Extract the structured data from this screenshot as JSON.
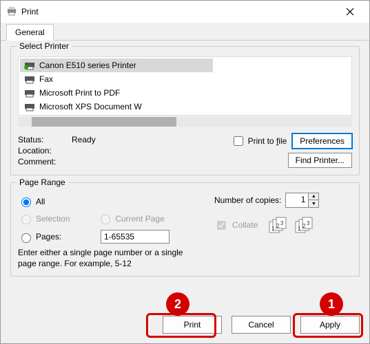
{
  "window": {
    "title": "Print"
  },
  "tabs": {
    "general": "General"
  },
  "select_printer": {
    "legend": "Select Printer",
    "printers": [
      {
        "name": "Canon E510 series Printer"
      },
      {
        "name": "Fax"
      },
      {
        "name": "Microsoft Print to PDF"
      },
      {
        "name": "Microsoft XPS Document W"
      }
    ]
  },
  "status": {
    "status_label": "Status:",
    "status_value": "Ready",
    "location_label": "Location:",
    "location_value": "",
    "comment_label": "Comment:",
    "comment_value": "",
    "print_to_file_prefix": "Print to ",
    "print_to_file_u": "f",
    "print_to_file_suffix": "ile",
    "preferences": "Preferences",
    "find_printer": "Find Printer..."
  },
  "page_range": {
    "legend": "Page Range",
    "all": "All",
    "selection": "Selection",
    "current_page": "Current Page",
    "pages": "Pages:",
    "pages_value": "1-65535",
    "hint": "Enter either a single page number or a single page range.  For example, 5-12",
    "copies_label": "Number of copies:",
    "copies_value": "1",
    "collate": "Collate"
  },
  "actions": {
    "print": "Print",
    "cancel": "Cancel",
    "apply": "Apply"
  },
  "callouts": {
    "one": "1",
    "two": "2"
  }
}
